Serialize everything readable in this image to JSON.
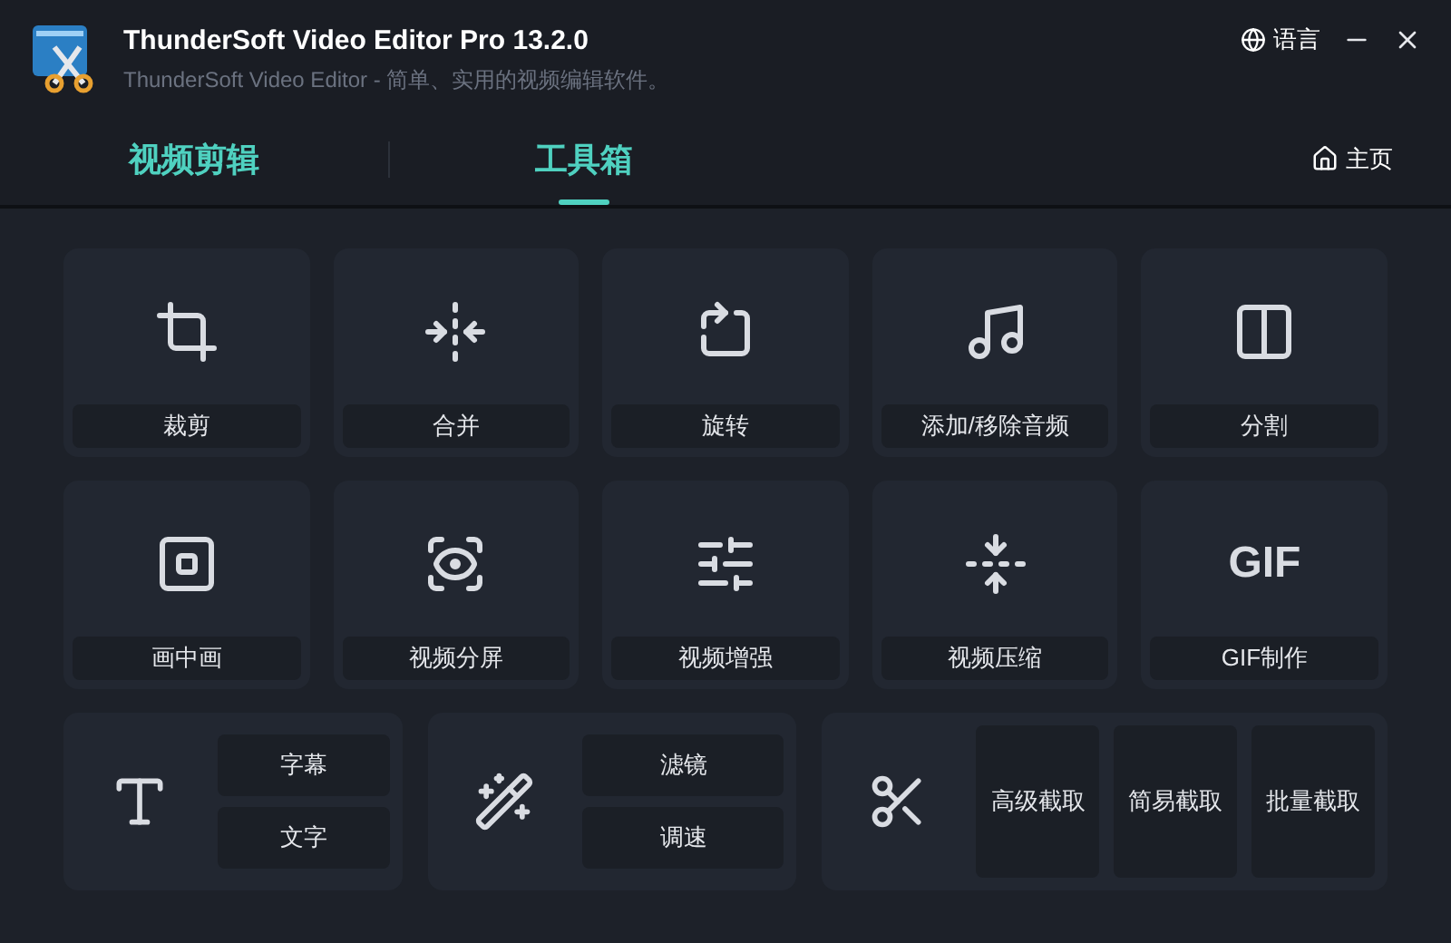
{
  "window": {
    "title": "ThunderSoft Video Editor Pro 13.2.0",
    "subtitle": "ThunderSoft Video Editor - 简单、实用的视频编辑软件。",
    "language": "语言"
  },
  "tabs": [
    {
      "label": "视频剪辑",
      "selected": false
    },
    {
      "label": "工具箱",
      "selected": true
    }
  ],
  "home": "主页",
  "tools": [
    {
      "kind": "icon",
      "label": "裁剪"
    },
    {
      "kind": "icon",
      "label": "合并"
    },
    {
      "kind": "icon",
      "label": "旋转"
    },
    {
      "kind": "icon",
      "label": "添加/移除音频"
    },
    {
      "kind": "icon",
      "label": "分割"
    },
    {
      "kind": "icon",
      "label": "画中画"
    },
    {
      "kind": "icon",
      "label": "视频分屏"
    },
    {
      "kind": "icon",
      "label": "视频增强"
    },
    {
      "kind": "icon",
      "label": "视频压缩"
    },
    {
      "kind": "text",
      "icon_text": "GIF",
      "label": "GIF制作"
    }
  ],
  "groups": [
    {
      "kind": "stack",
      "buttons": [
        "字幕",
        "文字"
      ]
    },
    {
      "kind": "stack",
      "buttons": [
        "滤镜",
        "调速"
      ]
    },
    {
      "kind": "row",
      "buttons": [
        "高级截取",
        "简易截取",
        "批量截取"
      ]
    }
  ]
}
